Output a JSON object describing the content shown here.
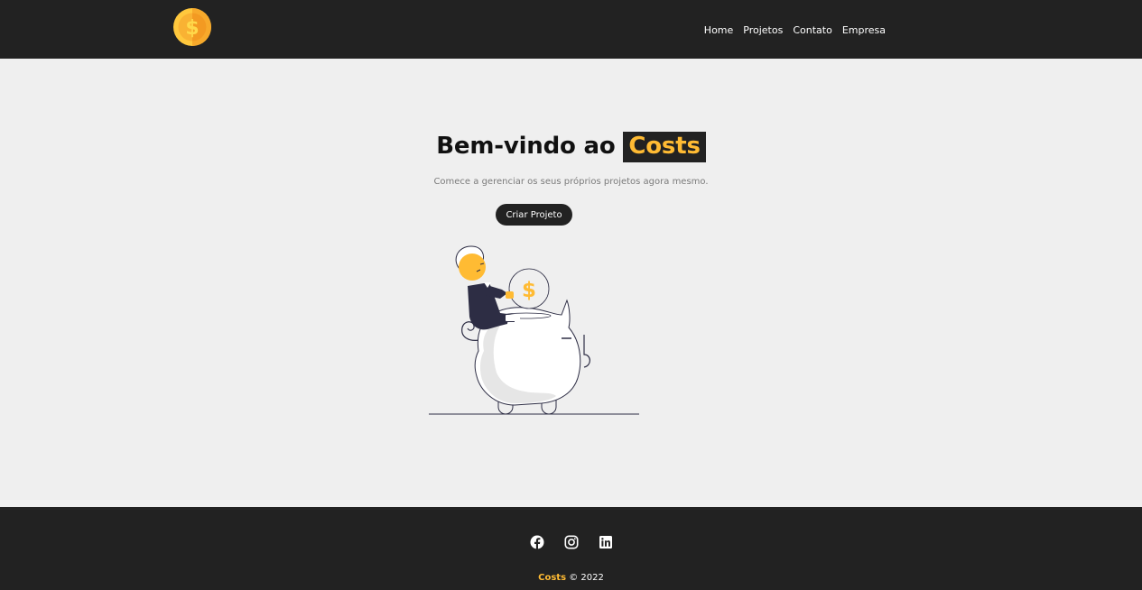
{
  "navbar": {
    "logo_icon": "coin-dollar-icon",
    "links": [
      {
        "label": "Home"
      },
      {
        "label": "Projetos"
      },
      {
        "label": "Contato"
      },
      {
        "label": "Empresa"
      }
    ]
  },
  "hero": {
    "title_prefix": "Bem-vindo ao",
    "title_brand": "Costs",
    "subtitle": "Comece a gerenciar os seus próprios projetos agora mesmo.",
    "cta_label": "Criar Projeto",
    "illustration": "person-depositing-coin-into-piggy-bank"
  },
  "footer": {
    "social": [
      {
        "icon": "facebook-icon"
      },
      {
        "icon": "instagram-icon"
      },
      {
        "icon": "linkedin-icon"
      }
    ],
    "brand": "Costs",
    "copyright": "© 2022"
  },
  "colors": {
    "dark": "#222222",
    "accent": "#ffbb33",
    "background": "#efefef"
  }
}
